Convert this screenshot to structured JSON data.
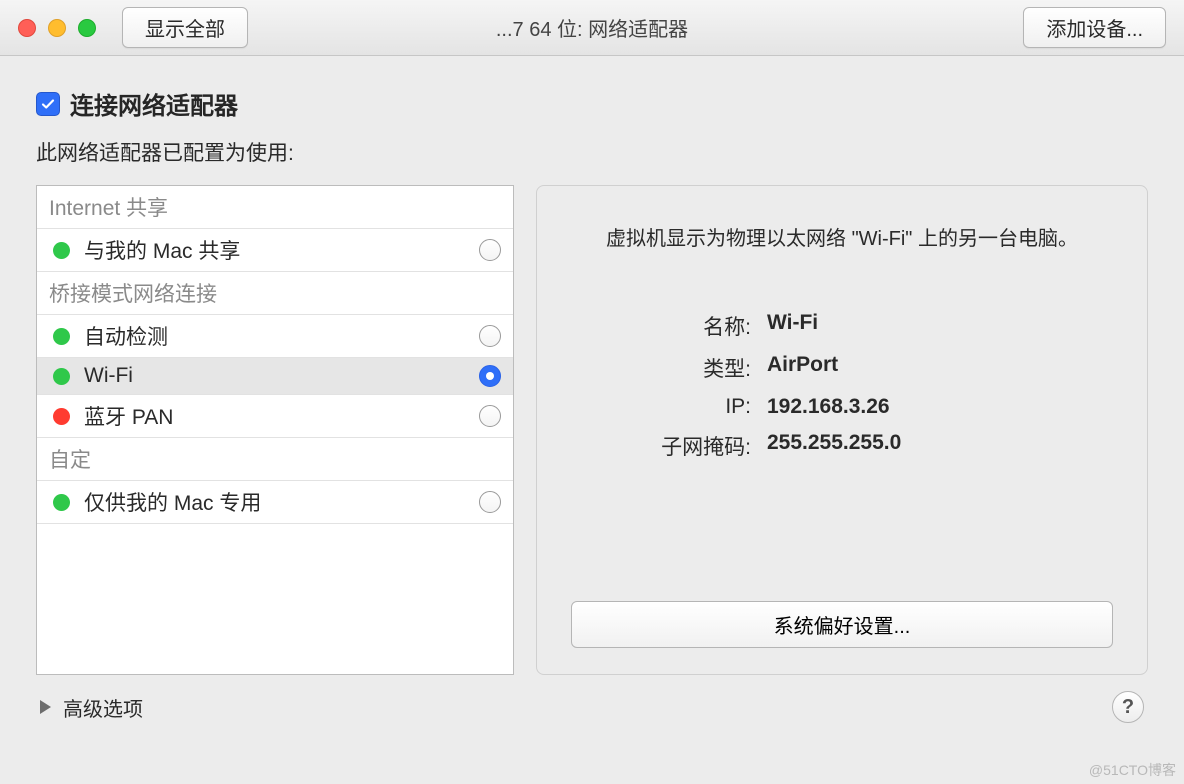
{
  "titlebar": {
    "show_all": "显示全部",
    "window_title": "...7 64 位: 网络适配器",
    "add_device": "添加设备..."
  },
  "main": {
    "checkbox_label": "连接网络适配器",
    "subtext": "此网络适配器已配置为使用:",
    "sections": [
      {
        "header": "Internet 共享",
        "items": [
          {
            "label": "与我的 Mac 共享",
            "status": "green",
            "selected": false
          }
        ]
      },
      {
        "header": "桥接模式网络连接",
        "items": [
          {
            "label": "自动检测",
            "status": "green",
            "selected": false
          },
          {
            "label": "Wi-Fi",
            "status": "green",
            "selected": true
          },
          {
            "label": "蓝牙 PAN",
            "status": "red",
            "selected": false
          }
        ]
      },
      {
        "header": "自定",
        "items": [
          {
            "label": "仅供我的 Mac 专用",
            "status": "green",
            "selected": false
          }
        ]
      }
    ],
    "detail": {
      "description": "虚拟机显示为物理以太网络 \"Wi-Fi\" 上的另一台电脑。",
      "fields": {
        "name_label": "名称:",
        "name_value": "Wi-Fi",
        "type_label": "类型:",
        "type_value": "AirPort",
        "ip_label": "IP:",
        "ip_value": "192.168.3.26",
        "subnet_label": "子网掩码:",
        "subnet_value": "255.255.255.0"
      },
      "sys_pref_button": "系统偏好设置..."
    }
  },
  "footer": {
    "advanced": "高级选项",
    "help": "?"
  },
  "watermark": "@51CTO博客"
}
